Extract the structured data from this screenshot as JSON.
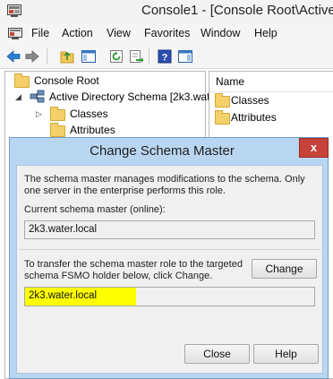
{
  "window": {
    "title": "Console1 - [Console Root\\Active"
  },
  "menu": {
    "items": [
      "File",
      "Action",
      "View",
      "Favorites",
      "Window",
      "Help"
    ]
  },
  "tree": {
    "root": "Console Root",
    "schema_node": "Active Directory Schema [2k3.wat",
    "children": [
      "Classes",
      "Attributes"
    ]
  },
  "list": {
    "column_header": "Name",
    "items": [
      "Classes",
      "Attributes"
    ]
  },
  "dialog": {
    "title": "Change Schema Master",
    "close_glyph": "x",
    "description": "The schema master manages modifications to the schema. Only one server in the enterprise performs this role.",
    "current_label": "Current schema master (online):",
    "current_value": "2k3.water.local",
    "transfer_text": "To transfer the schema master role to the targeted schema FSMO holder below, click Change.",
    "change_label": "Change",
    "target_value": "2k3.water.local",
    "close_label": "Close",
    "help_label": "Help"
  },
  "colors": {
    "dialog_frame": "#b9d6f1",
    "close_button": "#c7423a",
    "highlight": "#ffff00"
  }
}
